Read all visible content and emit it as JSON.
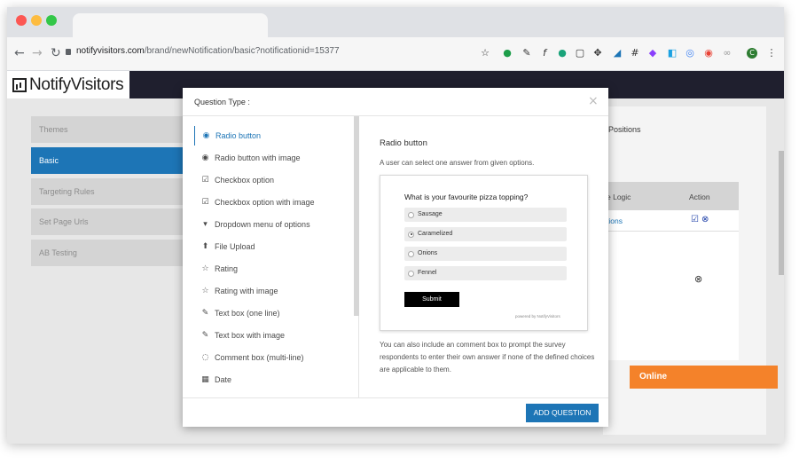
{
  "browser": {
    "url_host": "notifyvisitors.com",
    "url_path": "/brand/newNotification/basic?notificationid=15377",
    "profile_initial": "C"
  },
  "app": {
    "logo_text": "NotifyVisitors",
    "sidebar": [
      "Themes",
      "Basic",
      "Targeting Rules",
      "Set Page Urls",
      "AB Testing"
    ],
    "bg": {
      "tab_positions": "Positions",
      "col_logic": "e Logic",
      "col_action": "Action",
      "cell_options": "tions"
    },
    "online_label": "Online"
  },
  "modal": {
    "title": "Question Type :",
    "close": "×",
    "question_types": [
      {
        "label": "Radio button",
        "icon": "◉"
      },
      {
        "label": "Radio button with image",
        "icon": "◉"
      },
      {
        "label": "Checkbox option",
        "icon": "☑"
      },
      {
        "label": "Checkbox option with image",
        "icon": "☑"
      },
      {
        "label": "Dropdown menu of options",
        "icon": "▾"
      },
      {
        "label": "File Upload",
        "icon": "⬆"
      },
      {
        "label": "Rating",
        "icon": "☆"
      },
      {
        "label": "Rating with image",
        "icon": "☆"
      },
      {
        "label": "Text box (one line)",
        "icon": "✎"
      },
      {
        "label": "Text box with image",
        "icon": "✎"
      },
      {
        "label": "Comment box (multi-line)",
        "icon": "◌"
      },
      {
        "label": "Date",
        "icon": "▦"
      }
    ],
    "detail": {
      "title": "Radio button",
      "description": "A user can select one answer from given options.",
      "preview_question": "What is your favourite pizza topping?",
      "preview_options": [
        "Sausage",
        "Caramelized",
        "Onions",
        "Fennel"
      ],
      "preview_selected": 1,
      "preview_submit": "Submit",
      "preview_powered": "powered by NotifyVisitors",
      "note": "You can also include an comment box to prompt the survey respondents to enter their own answer if none of the defined choices are applicable to them."
    },
    "add_button": "ADD QUESTION"
  },
  "colors": {
    "accent": "#1d75b6",
    "online": "#f4822a",
    "header": "#1f1f2e"
  }
}
